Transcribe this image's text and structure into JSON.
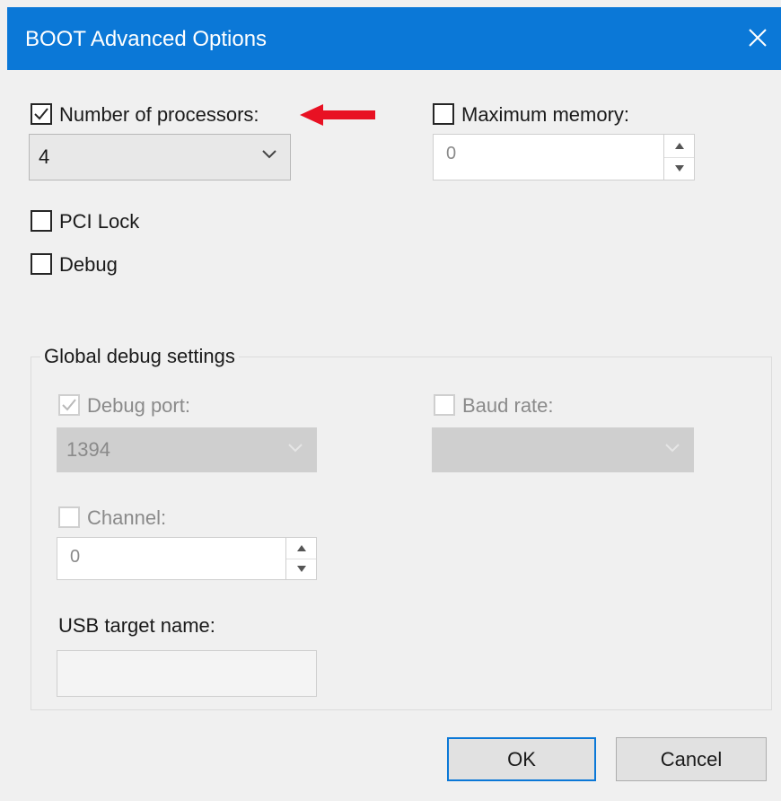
{
  "window": {
    "title": "BOOT Advanced Options",
    "close_icon": "close-icon"
  },
  "options": {
    "num_processors": {
      "label": "Number of processors:",
      "checked": true,
      "value": "4"
    },
    "max_memory": {
      "label": "Maximum memory:",
      "checked": false,
      "value": "0"
    },
    "pci_lock": {
      "label": "PCI Lock",
      "checked": false
    },
    "debug": {
      "label": "Debug",
      "checked": false
    }
  },
  "annotation": {
    "icon": "red-arrow-icon",
    "color": "#e81123"
  },
  "debug_settings": {
    "title": "Global debug settings",
    "debug_port": {
      "label": "Debug port:",
      "checked": true,
      "value": "1394"
    },
    "baud_rate": {
      "label": "Baud rate:",
      "checked": false,
      "value": ""
    },
    "channel": {
      "label": "Channel:",
      "checked": false,
      "value": "0"
    },
    "usb_target": {
      "label": "USB target name:",
      "value": ""
    }
  },
  "buttons": {
    "ok": "OK",
    "cancel": "Cancel"
  },
  "colors": {
    "titlebar": "#0b78d7",
    "background": "#f0f0f0",
    "accent": "#0b78d7"
  }
}
